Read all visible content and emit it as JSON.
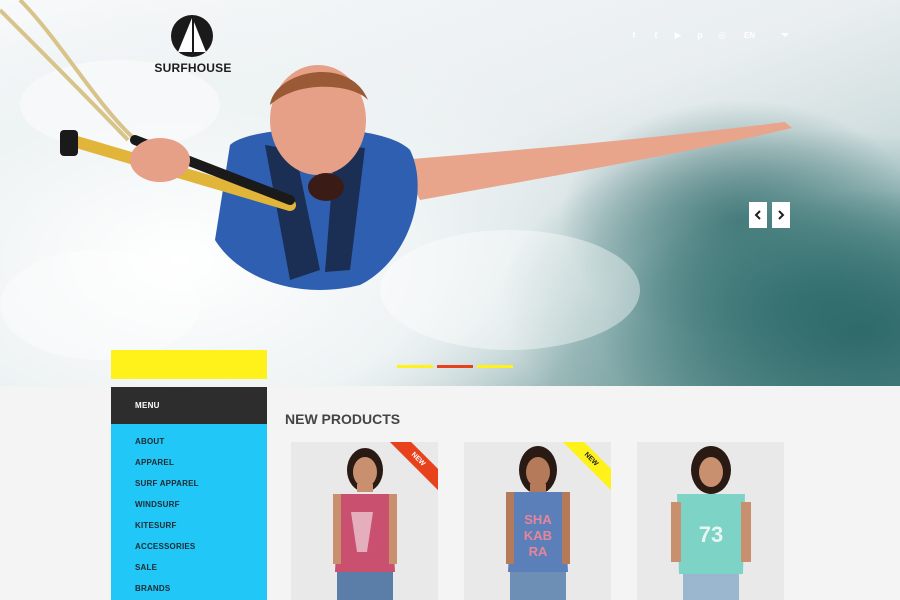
{
  "brand": {
    "name": "SURFHOUSE"
  },
  "header": {
    "social_icons": [
      "facebook-icon",
      "twitter-icon",
      "youtube-icon",
      "pinterest-icon",
      "instagram-icon"
    ],
    "social_glyphs": [
      "f",
      "t",
      "▶",
      "p",
      "◎"
    ],
    "language": "EN"
  },
  "slider": {
    "indicators": [
      {
        "color": "#fff21a",
        "active": false
      },
      {
        "color": "#e8421c",
        "active": true
      },
      {
        "color": "#fff21a",
        "active": false
      }
    ]
  },
  "sidebar": {
    "menu_title": "MENU",
    "items": [
      {
        "label": "ABOUT"
      },
      {
        "label": "APPAREL"
      },
      {
        "label": "SURF APPAREL"
      },
      {
        "label": "WINDSURF"
      },
      {
        "label": "KITESURF"
      },
      {
        "label": "ACCESSORIES"
      },
      {
        "label": "SALE"
      },
      {
        "label": "BRANDS"
      }
    ]
  },
  "products": {
    "title": "NEW PRODUCTS",
    "items": [
      {
        "badge": "NEW",
        "badge_color": "#e8421c",
        "badge_text_color": "#ffffff",
        "shirt_color": "#c9506e",
        "shirt_text": ""
      },
      {
        "badge": "NEW",
        "badge_color": "#fff21a",
        "badge_text_color": "#222222",
        "shirt_color": "#5b7fb8",
        "shirt_text": "SHA KAB RA"
      },
      {
        "badge": "",
        "badge_color": "",
        "badge_text_color": "",
        "shirt_color": "#7dd3c6",
        "shirt_text": "73"
      }
    ]
  },
  "colors": {
    "accent_yellow": "#fff21a",
    "accent_blue": "#21c7f6",
    "accent_red": "#e8421c",
    "dark": "#2d2d2d"
  }
}
